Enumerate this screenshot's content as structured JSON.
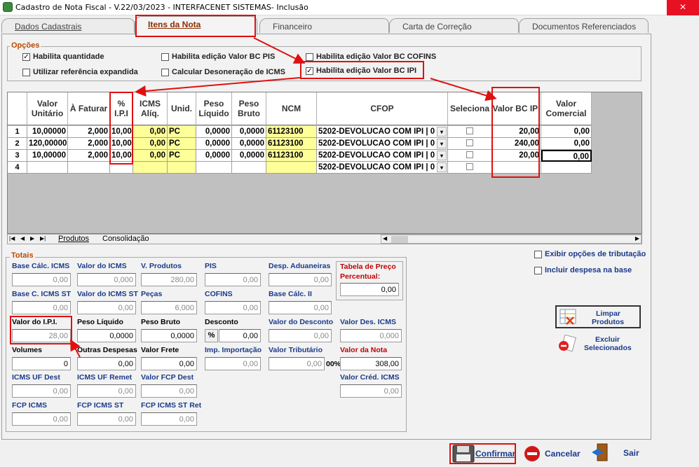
{
  "window": {
    "title": "Cadastro de Nota Fiscal - V.22/03/2023 - INTERFACENET SISTEMAS- Inclusão",
    "close_glyph": "×"
  },
  "tabs": [
    {
      "label": "Dados Cadastrais"
    },
    {
      "label": "Itens da Nota"
    },
    {
      "label": "Financeiro"
    },
    {
      "label": "Carta de Correção"
    },
    {
      "label": "Documentos Referenciados"
    }
  ],
  "options": {
    "title": "Opções",
    "items": [
      {
        "label": "Habilita quantidade",
        "checked": true
      },
      {
        "label": "Utilizar referência expandida",
        "checked": false
      },
      {
        "label": "Habilita edição Valor BC PIS",
        "checked": false
      },
      {
        "label": "Calcular Desoneração de ICMS",
        "checked": false
      },
      {
        "label": "Habilita edição Valor BC COFINS",
        "checked": false
      },
      {
        "label": "Habilita edição Valor BC IPI",
        "checked": true
      }
    ]
  },
  "grid": {
    "headers": [
      "Valor Unitário",
      "À Faturar",
      "% I.P.I",
      "ICMS Alíq.",
      "Unid.",
      "Peso Líquido",
      "Peso Bruto",
      "NCM",
      "CFOP",
      "Seleciona",
      "Valor BC IPI",
      "Valor Comercial"
    ],
    "rows": [
      {
        "n": "1",
        "vu": "10,00000",
        "fat": "2,000",
        "ipi": "10,00",
        "icms": "0,00",
        "un": "PC",
        "pl": "0,0000",
        "pb": "0,0000",
        "ncm": "61123100",
        "cfop": "5202-DEVOLUCAO COM IPI | 0",
        "bc": "20,00",
        "vc": "0,00"
      },
      {
        "n": "2",
        "vu": "120,00000",
        "fat": "2,000",
        "ipi": "10,00",
        "icms": "0,00",
        "un": "PC",
        "pl": "0,0000",
        "pb": "0,0000",
        "ncm": "61123100",
        "cfop": "5202-DEVOLUCAO COM IPI | 0",
        "bc": "240,00",
        "vc": "0,00"
      },
      {
        "n": "3",
        "vu": "10,00000",
        "fat": "2,000",
        "ipi": "10,00",
        "icms": "0,00",
        "un": "PC",
        "pl": "0,0000",
        "pb": "0,0000",
        "ncm": "61123100",
        "cfop": "5202-DEVOLUCAO COM IPI | 0",
        "bc": "20,00",
        "vc": "0,00"
      },
      {
        "n": "4",
        "vu": "",
        "fat": "",
        "ipi": "",
        "icms": "",
        "un": "",
        "pl": "",
        "pb": "",
        "ncm": "",
        "cfop": "5202-DEVOLUCAO COM IPI | 0",
        "bc": "",
        "vc": ""
      }
    ],
    "sheet_tabs": [
      "Produtos",
      "Consolidação"
    ],
    "nav": [
      "|◀",
      "◀",
      "▶",
      "▶|"
    ]
  },
  "totais": {
    "title": "Totais",
    "fields": {
      "base_calc_icms": {
        "label": "Base Cálc. ICMS",
        "value": "0,00"
      },
      "valor_icms": {
        "label": "Valor do ICMS",
        "value": "0,000"
      },
      "v_produtos": {
        "label": "V. Produtos",
        "value": "280,00"
      },
      "pis": {
        "label": "PIS",
        "value": "0,00"
      },
      "desp_aduaneiras": {
        "label": "Desp. Aduaneiras",
        "value": "0,00"
      },
      "base_icms_st": {
        "label": "Base C. ICMS ST",
        "value": "0,00"
      },
      "valor_icms_st": {
        "label": "Valor do ICMS ST",
        "value": "0,00"
      },
      "pecas": {
        "label": "Peças",
        "value": "6,000"
      },
      "cofins": {
        "label": "COFINS",
        "value": "0,00"
      },
      "base_calc_ii": {
        "label": "Base Cálc. II",
        "value": "0,00"
      },
      "valor_ipi": {
        "label": "Valor do I.P.I.",
        "value": "28,00"
      },
      "peso_liquido": {
        "label": "Peso Líquido",
        "value": "0,0000"
      },
      "peso_bruto": {
        "label": "Peso Bruto",
        "value": "0,0000"
      },
      "desconto": {
        "label": "Desconto",
        "value": "0,00",
        "pct": "%"
      },
      "valor_desconto": {
        "label": "Valor do Desconto",
        "value": "0,00"
      },
      "valor_des_icms": {
        "label": "Valor Des. ICMS",
        "value": "0,000"
      },
      "volumes": {
        "label": "Volumes",
        "value": "0"
      },
      "outras_despesas": {
        "label": "Outras Despesas",
        "value": "0,00"
      },
      "valor_frete": {
        "label": "Valor Frete",
        "value": "0,00"
      },
      "imp_importacao": {
        "label": "Imp. Importação",
        "value": "0,00"
      },
      "valor_tributario": {
        "label": "Valor Tributário",
        "value": "0,00",
        "pct": "00%"
      },
      "valor_nota": {
        "label": "Valor da Nota",
        "value": "308,00"
      },
      "icms_uf_dest": {
        "label": "ICMS UF Dest",
        "value": "0,00"
      },
      "icms_uf_remet": {
        "label": "ICMS UF Remet",
        "value": "0,00"
      },
      "valor_fcp_dest": {
        "label": "Valor FCP Dest",
        "value": "0,00"
      },
      "valor_cred_icms": {
        "label": "Valor Créd. ICMS",
        "value": "0,00"
      },
      "fcp_icms": {
        "label": "FCP ICMS",
        "value": "0,00"
      },
      "fcp_icms_st": {
        "label": "FCP ICMS ST",
        "value": "0,00"
      },
      "fcp_icms_st_ret": {
        "label": "FCP ICMS ST Ret",
        "value": "0,00"
      }
    },
    "tabela_preco": {
      "label1": "Tabela de Preço",
      "label2": "Percentual:",
      "value": "0,00"
    }
  },
  "side": {
    "exibir_opcoes": "Exibir opções de tributação",
    "incluir_despesa": "Incluir despesa na base",
    "limpar_line1": "Limpar",
    "limpar_line2": "Produtos",
    "excluir_line1": "Excluir",
    "excluir_line2": "Selecionados"
  },
  "footer": {
    "confirmar": "Confirmar",
    "cancelar": "Cancelar",
    "sair": "Sair"
  },
  "colors": {
    "highlight": "#e01010",
    "tab_active_text": "#8b2e00",
    "yellow_cell": "#ffff99"
  }
}
